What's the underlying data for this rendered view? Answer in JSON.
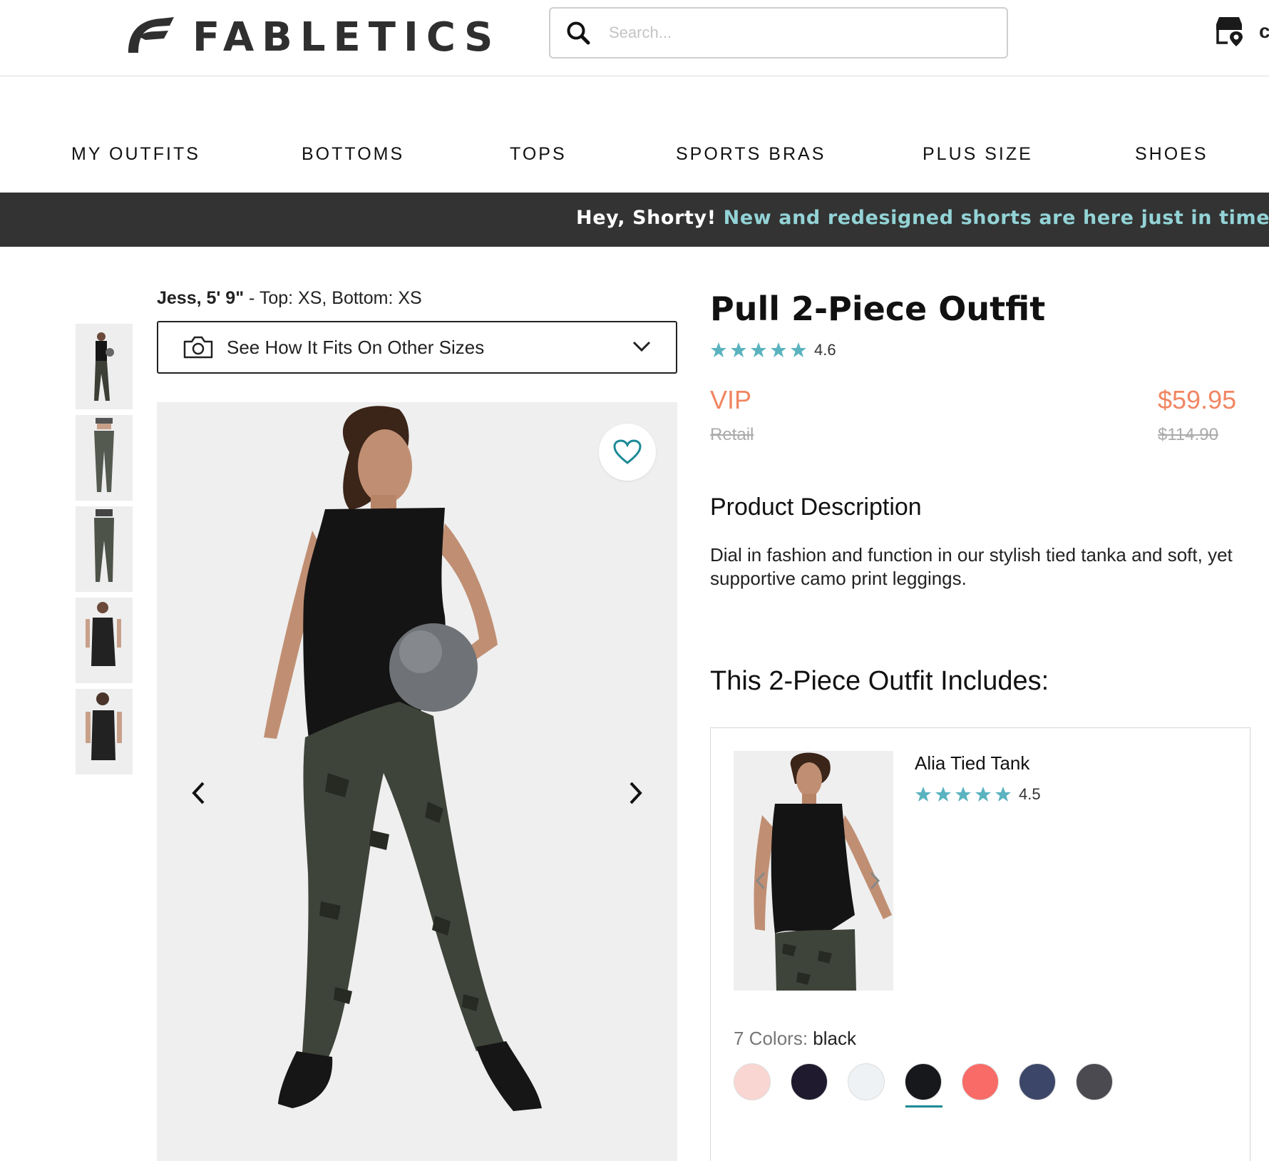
{
  "header": {
    "brand": "FABLETICS",
    "search_placeholder": "Search...",
    "account_glyph": "c",
    "icons": {
      "logo": "fabletics-logo-icon",
      "search": "search-icon",
      "store": "store-locator-icon"
    }
  },
  "nav": {
    "items": [
      "MY OUTFITS",
      "BOTTOMS",
      "TOPS",
      "SPORTS BRAS",
      "PLUS SIZE",
      "SHOES"
    ]
  },
  "promo": {
    "lead": "Hey, Shorty!",
    "text": "New and redesigned shorts are here just in time fo"
  },
  "model": {
    "name": "Jess, 5' 9\"",
    "sizes": " - Top: XS, Bottom: XS"
  },
  "fit_dropdown": {
    "label": "See How It Fits On Other Sizes"
  },
  "gallery": {
    "thumbnail_count": 5,
    "icons": [
      "heart-icon",
      "chevron-left-icon",
      "chevron-right-icon"
    ]
  },
  "product": {
    "title": "Pull 2-Piece Outfit",
    "rating": "4.6",
    "vip_label": "VIP",
    "vip_price": "$59.95",
    "retail_label": "Retail",
    "retail_price": "$114.90",
    "description_heading": "Product Description",
    "description": "Dial in fashion and function in our stylish tied tanka and soft, yet supportive camo print leggings.",
    "includes_heading": "This 2-Piece Outfit Includes:"
  },
  "included_item": {
    "name": "Alia Tied Tank",
    "rating": "4.5",
    "colors_label": "7 Colors:",
    "selected_color": "black",
    "swatches": [
      "#f9d6d1",
      "#1f1a2e",
      "#eef2f5",
      "#17181c",
      "#f86b66",
      "#3c4668",
      "#4b4a50"
    ]
  },
  "colors": {
    "accent_teal": "#1c8a95",
    "star": "#5ab3bf",
    "price": "#f08662",
    "promo_bg": "#333333",
    "promo_highlight": "#93d3d6"
  }
}
